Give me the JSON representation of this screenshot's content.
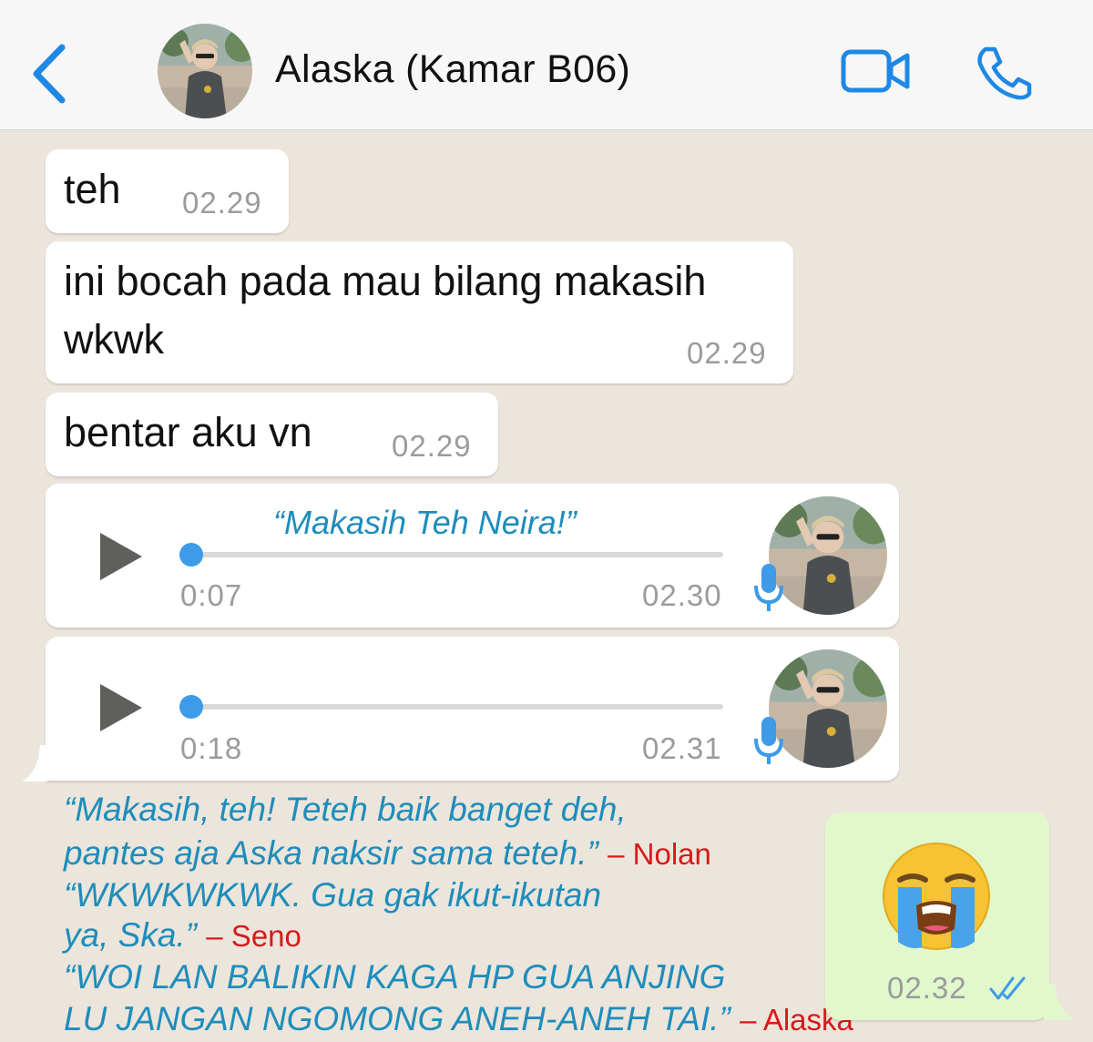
{
  "header": {
    "contact_name": "Alaska (Kamar B06)",
    "back_icon": "chevron-left-icon",
    "video_icon": "video-camera-icon",
    "call_icon": "phone-icon",
    "accent_color": "#1e88e5"
  },
  "messages": [
    {
      "text": "teh",
      "time": "02.29"
    },
    {
      "text_line1": "ini bocah pada mau bilang makasih",
      "text_line2": "wkwk",
      "time": "02.29"
    },
    {
      "text": "bentar aku vn",
      "time": "02.29"
    }
  ],
  "voice_notes": [
    {
      "caption": "“Makasih Teh Neira!”",
      "duration": "0:07",
      "time": "02.30",
      "progress": 0
    },
    {
      "duration": "0:18",
      "time": "02.31",
      "progress": 0
    }
  ],
  "quotes": {
    "q1_line1": "“Makasih, teh! Teteh baik banget deh,",
    "q1_line2": "pantes aja Aska naksir sama teteh.”",
    "q1_speaker": "– Nolan",
    "q2_line1": "“WKWKWKWK. Gua gak ikut-ikutan",
    "q2_line2": "ya, Ska.”",
    "q2_speaker": "– Seno",
    "q3_line1": "“WOI LAN BALIKIN KAGA HP GUA ANJING",
    "q3_line2": "LU JANGAN NGOMONG ANEH-ANEH TAI.”",
    "q3_speaker": "– Alaska"
  },
  "outgoing": {
    "emoji": "loudly-crying-face",
    "time": "02.32",
    "status_icon": "double-check-icon"
  }
}
